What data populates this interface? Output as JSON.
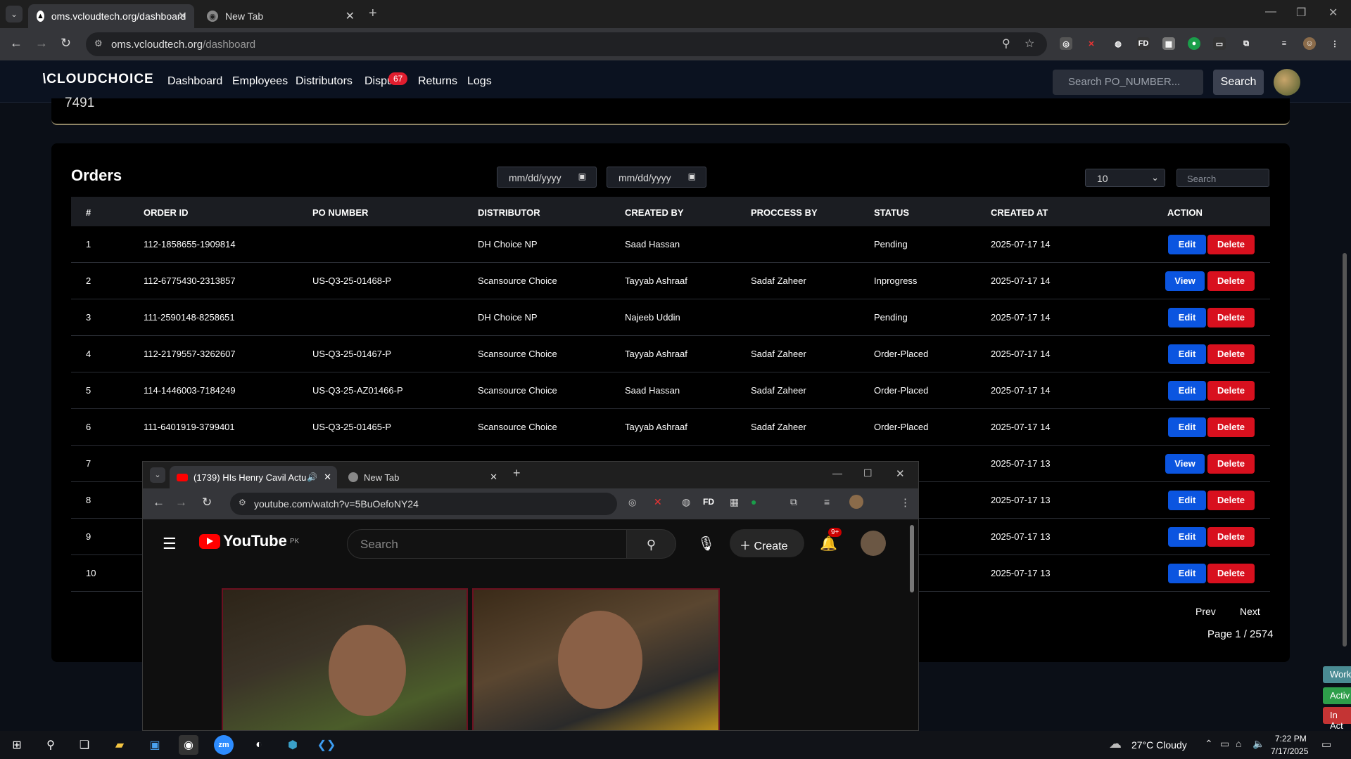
{
  "browser": {
    "tabs": [
      {
        "title": "oms.vcloudtech.org/dashboard",
        "active": true
      },
      {
        "title": "New Tab",
        "active": false
      }
    ],
    "url_host": "oms.vcloudtech.org",
    "url_path": "/dashboard"
  },
  "app": {
    "logo": "CLOUDCHOICE",
    "nav": [
      "Dashboard",
      "Employees",
      "Distributors",
      "Dispu",
      "Returns",
      "Logs"
    ],
    "dispute_badge": "67",
    "search_placeholder": "Search PO_NUMBER...",
    "search_button": "Search",
    "prev_card_value": "7491"
  },
  "orders": {
    "title": "Orders",
    "date_from": "mm/dd/yyyy",
    "date_to": "mm/dd/yyyy",
    "page_size": "10",
    "search_placeholder": "Search",
    "columns": [
      "#",
      "ORDER ID",
      "PO NUMBER",
      "DISTRIBUTOR",
      "CREATED BY",
      "PROCCESS BY",
      "STATUS",
      "CREATED AT",
      "ACTION"
    ],
    "rows": [
      {
        "n": "1",
        "order_id": "112-1858655-1909814",
        "po": "",
        "dist": "DH Choice NP",
        "created_by": "Saad Hassan",
        "process_by": "",
        "status": "Pending",
        "created_at": "2025-07-17 14",
        "action": "Edit"
      },
      {
        "n": "2",
        "order_id": "112-6775430-2313857",
        "po": "US-Q3-25-01468-P",
        "dist": "Scansource Choice",
        "created_by": "Tayyab Ashraaf",
        "process_by": "Sadaf Zaheer",
        "status": "Inprogress",
        "created_at": "2025-07-17 14",
        "action": "View"
      },
      {
        "n": "3",
        "order_id": "111-2590148-8258651",
        "po": "",
        "dist": "DH Choice NP",
        "created_by": "Najeeb Uddin",
        "process_by": "",
        "status": "Pending",
        "created_at": "2025-07-17 14",
        "action": "Edit"
      },
      {
        "n": "4",
        "order_id": "112-2179557-3262607",
        "po": "US-Q3-25-01467-P",
        "dist": "Scansource Choice",
        "created_by": "Tayyab Ashraaf",
        "process_by": "Sadaf Zaheer",
        "status": "Order-Placed",
        "created_at": "2025-07-17 14",
        "action": "Edit"
      },
      {
        "n": "5",
        "order_id": "114-1446003-7184249",
        "po": "US-Q3-25-AZ01466-P",
        "dist": "Scansource Choice",
        "created_by": "Saad Hassan",
        "process_by": "Sadaf Zaheer",
        "status": "Order-Placed",
        "created_at": "2025-07-17 14",
        "action": "Edit"
      },
      {
        "n": "6",
        "order_id": "111-6401919-3799401",
        "po": "US-Q3-25-01465-P",
        "dist": "Scansource Choice",
        "created_by": "Tayyab Ashraaf",
        "process_by": "Sadaf Zaheer",
        "status": "Order-Placed",
        "created_at": "2025-07-17 14",
        "action": "Edit"
      },
      {
        "n": "7",
        "order_id": "",
        "po": "",
        "dist": "",
        "created_by": "",
        "process_by": "",
        "status": "",
        "created_at": "2025-07-17 13",
        "action": "View"
      },
      {
        "n": "8",
        "order_id": "",
        "po": "",
        "dist": "",
        "created_by": "",
        "process_by": "",
        "status": "ed",
        "created_at": "2025-07-17 13",
        "action": "Edit"
      },
      {
        "n": "9",
        "order_id": "",
        "po": "",
        "dist": "",
        "created_by": "",
        "process_by": "",
        "status": "ed",
        "created_at": "2025-07-17 13",
        "action": "Edit"
      },
      {
        "n": "10",
        "order_id": "",
        "po": "",
        "dist": "",
        "created_by": "",
        "process_by": "",
        "status": "ed",
        "created_at": "2025-07-17 13",
        "action": "Edit"
      }
    ],
    "delete_label": "Delete",
    "prev_label": "Prev",
    "next_label": "Next",
    "page_info": "Page 1 / 2574"
  },
  "side_tags": [
    "Work",
    "Activ",
    "In Act"
  ],
  "popup": {
    "tabs": [
      {
        "title": "(1739) HIs Henry Cavil Actu",
        "active": true
      },
      {
        "title": "New Tab",
        "active": false
      }
    ],
    "url": "youtube.com/watch?v=5BuOefoNY24",
    "yt_logo": "YouTube",
    "yt_region": "PK",
    "yt_search_placeholder": "Search",
    "yt_create": "Create",
    "yt_notif_badge": "9+"
  },
  "taskbar": {
    "weather": "27°C  Cloudy",
    "time": "7:22 PM",
    "date": "7/17/2025",
    "zoom_label": "zm"
  },
  "colors": {
    "edit_button": "#0b55e0",
    "delete_button": "#d8101e",
    "badge": "#e11d2e"
  }
}
